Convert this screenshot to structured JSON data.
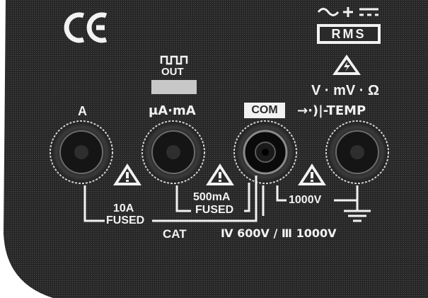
{
  "marks": {
    "ce": "CE",
    "rms": "RMS",
    "out": "OUT",
    "com": "COM"
  },
  "terminals": {
    "a": {
      "label": "A"
    },
    "ua_ma": {
      "label": "μA·mA"
    },
    "com": {
      "label": "COM"
    },
    "v": {
      "label_top": "V · mV · Ω",
      "label_bottom": "→·)|-TEMP"
    }
  },
  "ratings": {
    "a": {
      "line1": "10A",
      "line2": "FUSED"
    },
    "ua_ma": {
      "line1": "500mA",
      "line2": "FUSED"
    },
    "v": {
      "line1": "1000V"
    }
  },
  "category": {
    "cat": "CAT",
    "rating": "Ⅳ 600V / Ⅲ 1000V"
  },
  "colors": {
    "panel": "#2b2b2b",
    "text": "#f2f2f2",
    "background": "#ffffff"
  },
  "icons": [
    "ce-mark-icon",
    "ac-dc-icon",
    "rms-badge-icon",
    "warning-icon",
    "ground-icon",
    "square-wave-icon"
  ]
}
